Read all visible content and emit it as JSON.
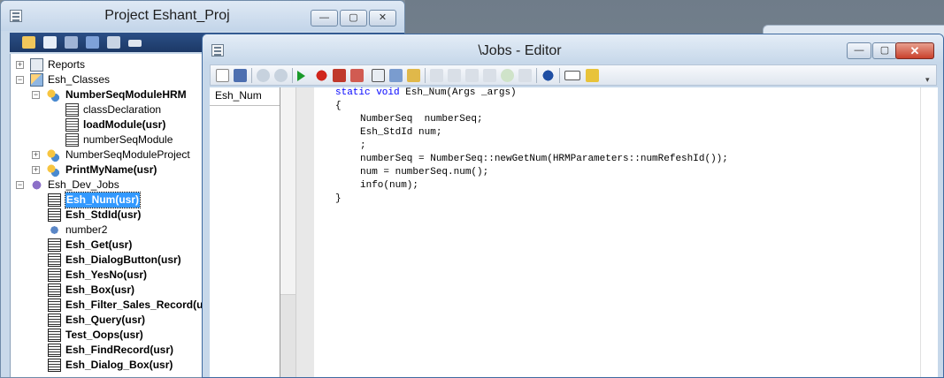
{
  "project_window": {
    "title": "Project Eshant_Proj",
    "buttons": {
      "minimize": "—",
      "maximize": "▢",
      "close": "✕"
    },
    "tree": [
      {
        "label": "Reports",
        "icon": "reports-icon",
        "bold": false
      },
      {
        "label": "Esh_Classes",
        "icon": "classes-folder-icon",
        "bold": false
      },
      {
        "label": "NumberSeqModuleHRM",
        "icon": "class-icon",
        "bold": true
      },
      {
        "label": "classDeclaration",
        "icon": "method-icon",
        "bold": false
      },
      {
        "label": "loadModule(usr)",
        "icon": "method-icon",
        "bold": true
      },
      {
        "label": "numberSeqModule",
        "icon": "method-icon",
        "bold": false
      },
      {
        "label": "NumberSeqModuleProject",
        "icon": "class-icon",
        "bold": false
      },
      {
        "label": "PrintMyName(usr)",
        "icon": "class-icon",
        "bold": true
      },
      {
        "label": "Esh_Dev_Jobs",
        "icon": "jobs-folder-icon",
        "bold": false
      },
      {
        "label": "Esh_Num(usr)",
        "icon": "job-icon",
        "bold": true,
        "selected": true
      },
      {
        "label": "Esh_StdId(usr)",
        "icon": "job-icon",
        "bold": true
      },
      {
        "label": "number2",
        "icon": "gear-job-icon",
        "bold": false
      },
      {
        "label": "Esh_Get(usr)",
        "icon": "job-icon",
        "bold": true
      },
      {
        "label": "Esh_DialogButton(usr)",
        "icon": "job-icon",
        "bold": true
      },
      {
        "label": "Esh_YesNo(usr)",
        "icon": "job-icon",
        "bold": true
      },
      {
        "label": "Esh_Box(usr)",
        "icon": "job-icon",
        "bold": true
      },
      {
        "label": "Esh_Filter_Sales_Record(usr)",
        "icon": "job-icon",
        "bold": true
      },
      {
        "label": "Esh_Query(usr)",
        "icon": "job-icon",
        "bold": true
      },
      {
        "label": "Test_Oops(usr)",
        "icon": "job-icon",
        "bold": true
      },
      {
        "label": "Esh_FindRecord(usr)",
        "icon": "job-icon",
        "bold": true
      },
      {
        "label": "Esh_Dialog_Box(usr)",
        "icon": "job-icon",
        "bold": true
      }
    ]
  },
  "editor_window": {
    "title": "\\Jobs - Editor",
    "buttons": {
      "minimize": "—",
      "maximize": "▢",
      "close": "✕"
    },
    "method_list": [
      "Esh_Num"
    ],
    "code_lines": [
      {
        "indent": 0,
        "text": "static void Esh_Num(Args _args)",
        "keyword": "static void"
      },
      {
        "indent": 0,
        "text": "{"
      },
      {
        "indent": 1,
        "text": "NumberSeq  numberSeq;"
      },
      {
        "indent": 1,
        "text": "Esh_StdId num;"
      },
      {
        "indent": 1,
        "text": ";"
      },
      {
        "indent": 1,
        "text": "numberSeq = NumberSeq::newGetNum(HRMParameters::numRefeshId());"
      },
      {
        "indent": 1,
        "text": "num = numberSeq.num();"
      },
      {
        "indent": 1,
        "text": "info(num);"
      },
      {
        "indent": 0,
        "text": "}"
      }
    ]
  },
  "colors": {
    "keyword": "#0000ff",
    "selection": "#3399ff",
    "project_toolbar": "#2b4f86",
    "close_button": "#c9412c"
  }
}
